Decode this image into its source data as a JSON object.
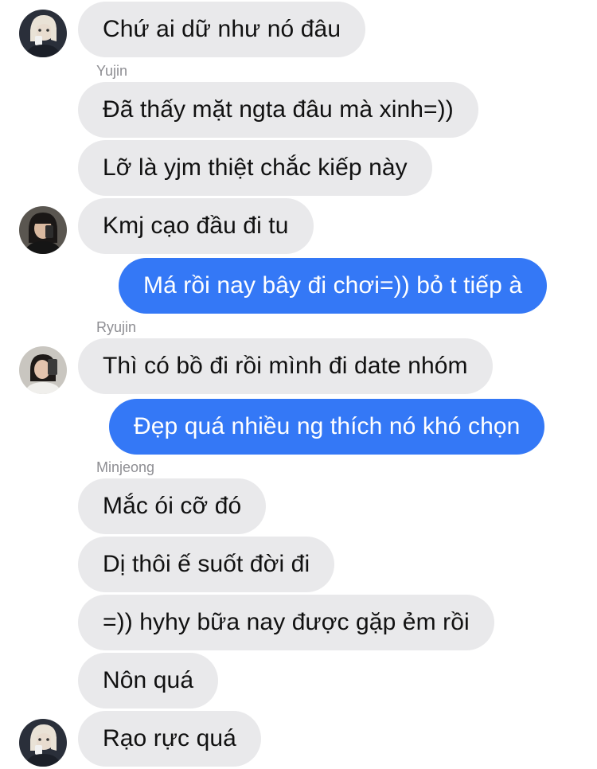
{
  "messages": [
    {
      "text": "Chứ ai dữ như nó đâu"
    },
    {
      "text": "Đã thấy mặt ngta đâu mà xinh=))"
    },
    {
      "text": "Lỡ là yjm thiệt chắc kiếp này"
    },
    {
      "text": "Kmj cạo đầu đi tu"
    },
    {
      "text": "Má rồi nay bây đi chơi=)) bỏ t tiếp à"
    },
    {
      "text": "Thì có bồ đi rồi mình đi date nhóm"
    },
    {
      "text": "Đẹp quá nhiều ng thích nó khó chọn"
    },
    {
      "text": "Mắc ói cỡ đó"
    },
    {
      "text": "Dị thôi ế suốt đời đi"
    },
    {
      "text": "=)) hyhy bữa nay được gặp ẻm rồi"
    },
    {
      "text": "Nôn quá"
    },
    {
      "text": "Rạo rực quá"
    }
  ],
  "senders": {
    "yujin": "Yujin",
    "ryujin": "Ryujin",
    "minjeong": "Minjeong"
  },
  "colors": {
    "incoming_bubble": "#e9e9eb",
    "outgoing_bubble": "#3478f6",
    "sender_label": "#8e8e93"
  }
}
